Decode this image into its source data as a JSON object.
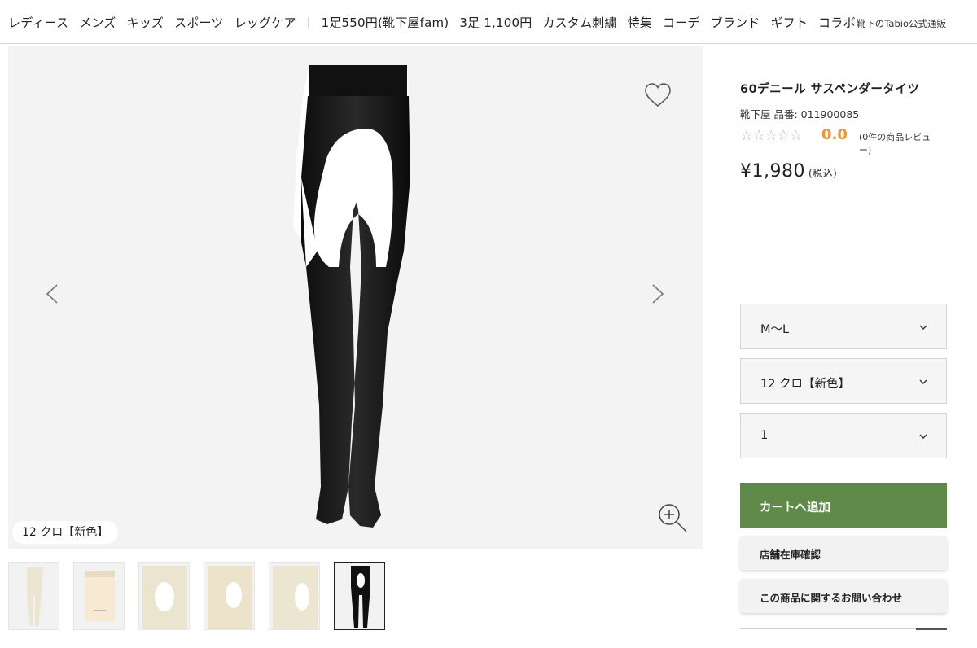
{
  "nav": {
    "items": [
      "レディース",
      "メンズ",
      "キッズ",
      "スポーツ",
      "レッグケア",
      "|",
      "1足550円(靴下屋fam)",
      "3足 1,100円",
      "カスタム刺繍",
      "特集",
      "コーデ",
      "ブランド",
      "ギフト",
      "コラボ"
    ],
    "right_link": "靴下のTabio公式通販"
  },
  "gallery": {
    "color_label": "12 クロ【新色】",
    "icons": {
      "prev": "chevron-left-icon",
      "next": "chevron-right-icon",
      "favorite": "heart-icon",
      "zoom": "zoom-in-icon"
    },
    "thumbnail_count": 6,
    "active_thumbnail": 6
  },
  "product": {
    "title": "60デニール サスペンダータイツ",
    "brand_line": "靴下屋 品番: 011900085",
    "stars": "☆☆☆☆☆",
    "rating": "0.0",
    "review_count": "(0件の商品レビュー)",
    "price": "¥1,980",
    "tax": "(税込)"
  },
  "options": {
    "size": "M〜L",
    "color": "12 クロ【新色】",
    "quantity": "1"
  },
  "actions": {
    "add_to_cart": "カートへ追加",
    "store_stock": "店舗在庫確認",
    "inquiry": "この商品に関するお問い合わせ"
  },
  "colors": {
    "cart_green": "#5f8a49",
    "rating_orange": "#e8963a",
    "image_bg": "#f3f3f3"
  }
}
